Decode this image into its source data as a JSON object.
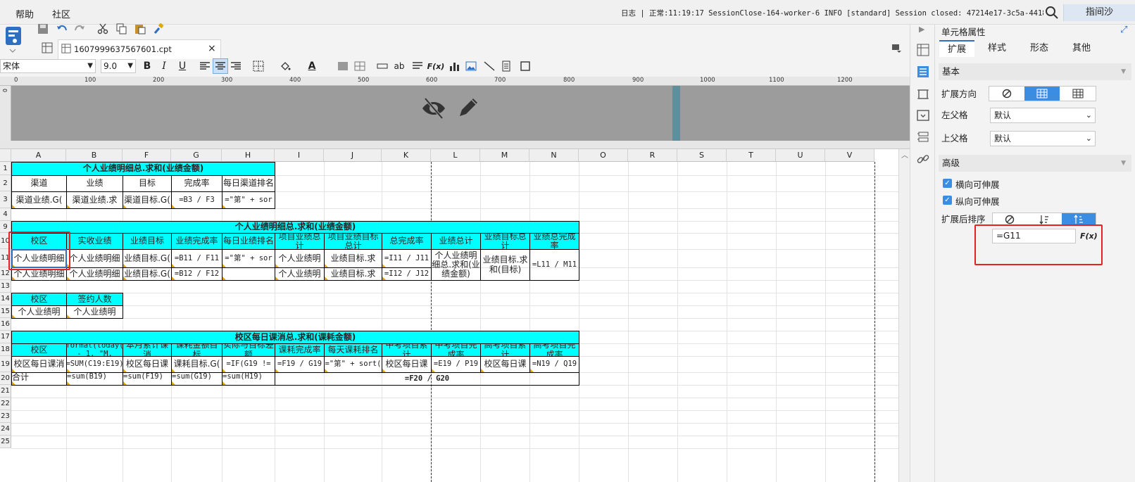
{
  "menubar": {
    "help": "帮助",
    "community": "社区",
    "log_text": "日志 | 正常:11:19:17 SessionClose-164-worker-6 INFO [standard] Session closed: 47214e17-3c5a-4418...",
    "user": "指间沙"
  },
  "tab": {
    "file_name": "1607999637567601.cpt"
  },
  "format": {
    "font": "宋体",
    "size": "9.0"
  },
  "ruler": {
    "ticks": [
      "0",
      "100",
      "200",
      "300",
      "400",
      "500",
      "600",
      "700",
      "800",
      "900",
      "1000",
      "1100",
      "1200"
    ]
  },
  "columns": [
    "A",
    "B",
    "F",
    "G",
    "H",
    "I",
    "J",
    "K",
    "L",
    "M",
    "N",
    "O",
    "R",
    "S",
    "T",
    "U",
    "V"
  ],
  "rows": [
    "1",
    "2",
    "3",
    "4",
    "9",
    "10",
    "11",
    "12",
    "13",
    "14",
    "15",
    "16",
    "17",
    "18",
    "19",
    "20",
    "21",
    "22",
    "23",
    "24",
    "25"
  ],
  "sheet": {
    "r1": "个人业绩明细总.求和(业绩金额)",
    "r2": [
      "渠道",
      "业绩",
      "目标",
      "完成率",
      "每日渠道排名"
    ],
    "r3": [
      "渠道业绩.G(",
      "渠道业绩.求",
      "渠道目标.G(",
      "=B3 / F3",
      "=\"第\" + sor"
    ],
    "r9": "个人业绩明细总.求和(业绩金额)",
    "r10": [
      "校区",
      "实收业绩",
      "业绩目标",
      "业绩完成率",
      "每日业绩排名",
      "项目业绩总计",
      "项目业绩目标总计",
      "总完成率",
      "业绩总计",
      "业绩目标总计",
      "业绩总完成率"
    ],
    "r11": [
      "个人业绩明细",
      "个人业绩明细",
      "业绩目标.G(",
      "=B11 / F11",
      "=\"第\" + sor",
      "个人业绩明",
      "业绩目标.求",
      "=I11 / J11",
      "个人业绩明细总.求和(业绩金额)",
      "业绩目标.求和(目标)",
      "=L11 / M11"
    ],
    "r12": [
      "个人业绩明细",
      "个人业绩明细",
      "业绩目标.G(",
      "=B12 / F12",
      "",
      "个人业绩明",
      "业绩目标.求",
      "=I12 / J12"
    ],
    "r14": [
      "校区",
      "签约人数"
    ],
    "r15": [
      "个人业绩明",
      "个人业绩明"
    ],
    "r17": "校区每日课消总.求和(课耗金额)",
    "r18": [
      "校区",
      "=format(today() - 1, \"M.",
      "本月累计课消",
      "课耗金额目标",
      "实际与目标差额",
      "课耗完成率",
      "每天课耗排名",
      "中考项目累计",
      "中考项目完成率",
      "高考项目累计",
      "高考项目完成率"
    ],
    "r19": [
      "校区每日课消",
      "=SUM(C19:E19)",
      "校区每日课",
      "课耗目标.G(",
      "=IF(G19 !=",
      "=F19 / G19",
      "=\"第\" + sort(",
      "校区每日课",
      "=E19 / P19",
      "校区每日课",
      "=N19 / Q19"
    ],
    "r20": [
      "合计",
      "=sum(B19)",
      "=sum(F19)",
      "=sum(G19)",
      "=sum(H19)",
      "=F20 / G20"
    ]
  },
  "panel": {
    "title": "单元格属性",
    "tabs": [
      "扩展",
      "样式",
      "形态",
      "其他"
    ],
    "basic": "基本",
    "expand_dir": "扩展方向",
    "left_parent": "左父格",
    "left_parent_value": "默认",
    "up_parent": "上父格",
    "up_parent_value": "默认",
    "advanced": "高级",
    "h_expand": "横向可伸展",
    "v_expand": "纵向可伸展",
    "sort_after": "扩展后排序",
    "formula": "=G11",
    "fx": "F(x)"
  },
  "colors": {
    "cyan": "#00ffff",
    "accent": "#3b8de2",
    "highlight": "#e52222"
  }
}
